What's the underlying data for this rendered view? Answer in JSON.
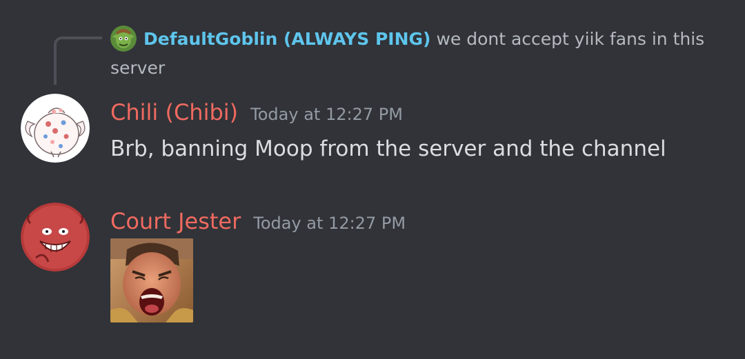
{
  "reply": {
    "author": "DefaultGoblin (ALWAYS PING)",
    "text": "we dont accept yiik fans in this server",
    "avatar_icon": "goblin-avatar-icon"
  },
  "messages": [
    {
      "author": "Chili (Chibi)",
      "timestamp": "Today at 12:27 PM",
      "content": "Brb, banning Moop from the server and the channel",
      "author_color": "#f06a60",
      "avatar_icon": "togepi-avatar-icon"
    },
    {
      "author": "Court Jester",
      "timestamp": "Today at 12:27 PM",
      "content": "",
      "author_color": "#f06a60",
      "avatar_icon": "jester-avatar-icon",
      "attachment": "screaming-man-image"
    }
  ],
  "colors": {
    "background": "#313338",
    "reply_author": "#5ec5ec",
    "timestamp": "#949ba4",
    "text": "#dbdee1"
  }
}
